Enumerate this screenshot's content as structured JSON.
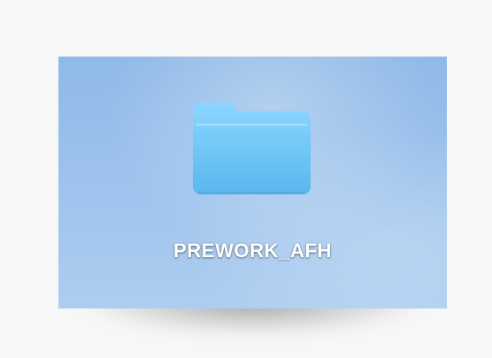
{
  "desktop": {
    "items": [
      {
        "label": "PREWORK_AFH",
        "icon": "folder-icon"
      }
    ]
  },
  "colors": {
    "page_background": "#f7f7f8",
    "desktop_blue": "#9cc2ec",
    "folder_blue": "#75c9f8",
    "label_text": "#ffffff"
  }
}
